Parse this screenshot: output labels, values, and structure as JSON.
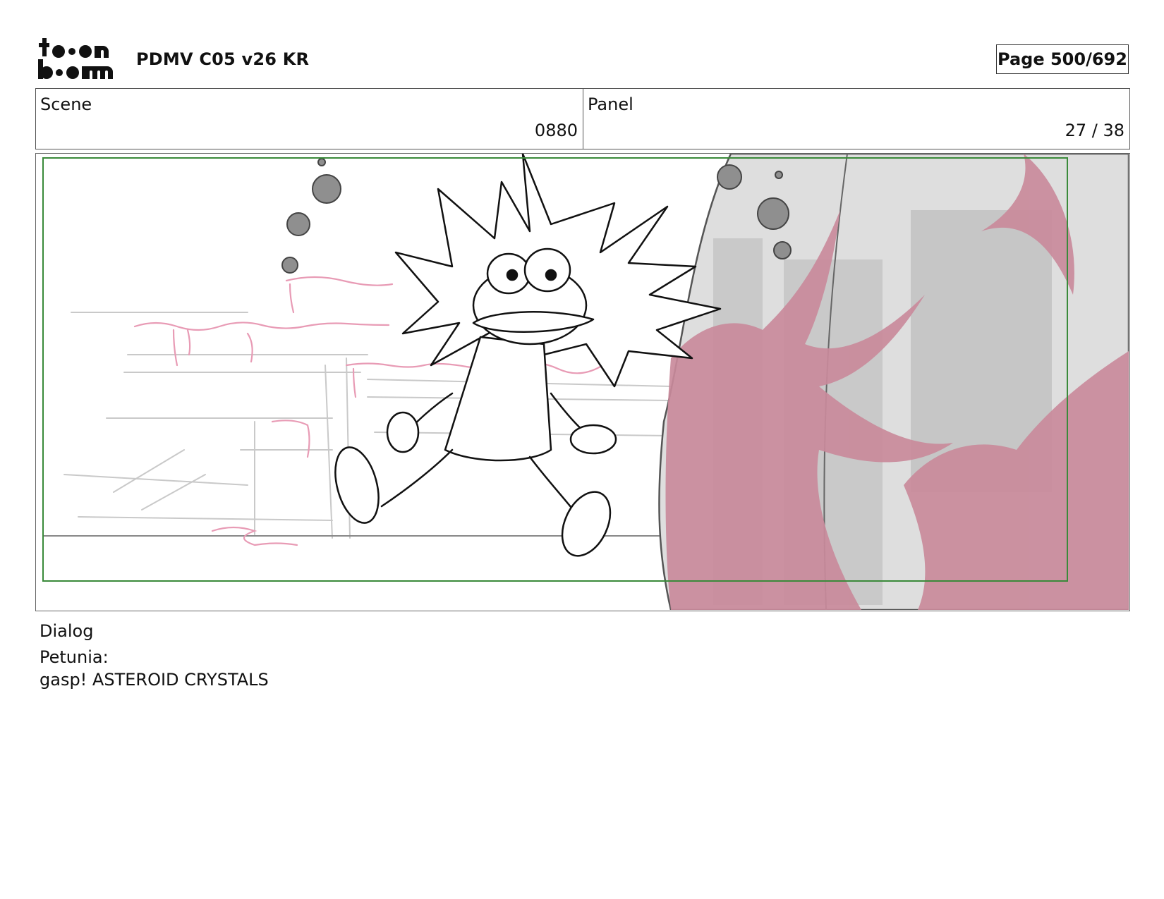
{
  "header": {
    "logo_text_top": "toon",
    "logo_text_bottom": "boom",
    "title": "PDMV C05 v26 KR",
    "page_label": "Page 500/692"
  },
  "info": {
    "scene_label": "Scene",
    "scene_value": "0880",
    "panel_label": "Panel",
    "panel_value": "27 / 38"
  },
  "dialog": {
    "label": "Dialog",
    "speaker": "Petunia:",
    "line": "gasp!  ASTEROID CRYSTALS"
  },
  "colors": {
    "crystal_pink": "#c98a9b",
    "sketch_pink": "#e89bb5",
    "safe_frame_green": "#3a8a3a",
    "rock_gray": "#d8d8d8"
  }
}
